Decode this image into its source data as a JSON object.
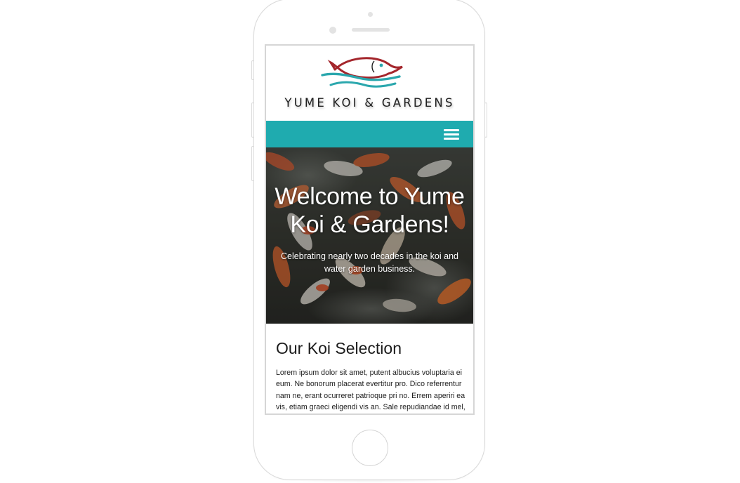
{
  "site": {
    "logo_text": "YUME KOI & GARDENS"
  },
  "nav": {
    "menu_icon": "hamburger-menu-icon"
  },
  "hero": {
    "title": "Welcome to Yume Koi & Gardens!",
    "subtitle": "Celebrating nearly two decades in the koi and water garden business."
  },
  "section": {
    "title": "Our Koi Selection",
    "body": "Lorem ipsum dolor sit amet, putent albucius voluptaria ei eum. Ne bonorum placerat evertitur pro. Dico referrentur nam ne, erant ocurreret patrioque pri no. Errem aperiri ea vis, etiam graeci eligendi vis an. Sale repudiandae id mel, ius ne equidem dissentiet. Ea per nisl blandit, iudicabit"
  },
  "colors": {
    "nav_teal": "#1fabaf",
    "logo_red": "#a4262c",
    "logo_teal": "#2aa7ad"
  }
}
